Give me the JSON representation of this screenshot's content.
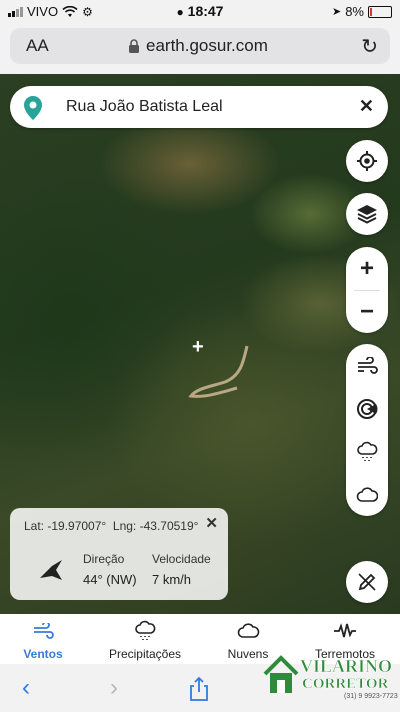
{
  "status_bar": {
    "carrier": "VIVO",
    "time": "18:47",
    "battery": "8%"
  },
  "browser": {
    "text_size_label": "AA",
    "url": "earth.gosur.com"
  },
  "search": {
    "address": "Rua João Batista Leal"
  },
  "map_controls": {
    "zoom_in_label": "+",
    "zoom_out_label": "−",
    "icons": [
      "locate-icon",
      "layers-icon",
      "wind-icon",
      "radar-icon",
      "rain-cloud-icon",
      "cloud-icon",
      "edit-pen-icon"
    ]
  },
  "info_card": {
    "lat_label": "Lat:",
    "lat_value": "-19.97007°",
    "lng_label": "Lng:",
    "lng_value": "-43.70519°",
    "direction_label": "Direção",
    "direction_value": "44° (NW)",
    "speed_label": "Velocidade",
    "speed_value": "7 km/h"
  },
  "bottom_tabs": [
    {
      "label": "Ventos",
      "icon": "wind-icon",
      "active": true
    },
    {
      "label": "Precipitações",
      "icon": "rain-cloud-icon",
      "active": false
    },
    {
      "label": "Nuvens",
      "icon": "cloud-icon",
      "active": false
    },
    {
      "label": "Terremotos",
      "icon": "seismic-icon",
      "active": false
    }
  ],
  "watermark": {
    "line1": "VILARINO",
    "line2": "CORRETOR",
    "phone": "(31) 9 9923-7723"
  },
  "colors": {
    "accent": "#3a7bd5",
    "pin": "#27a39a",
    "watermark_green": "#2e8b3a"
  }
}
